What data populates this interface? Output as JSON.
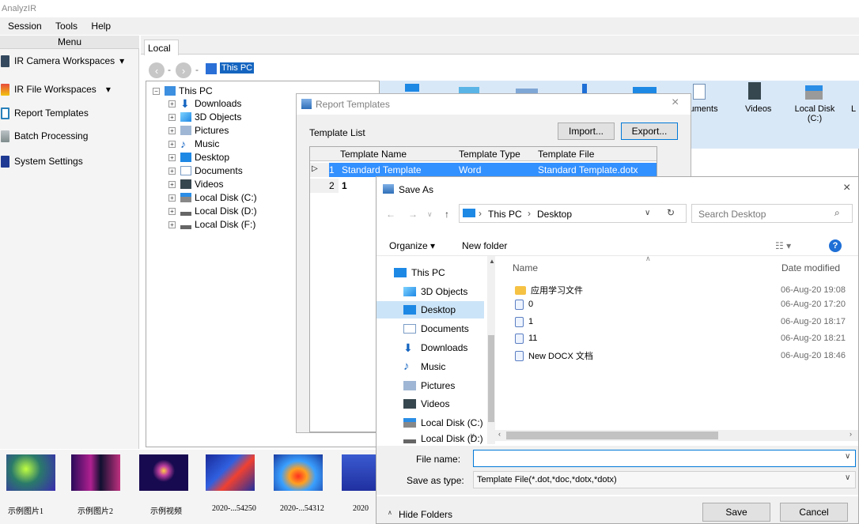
{
  "app": {
    "title": "AnalyzIR"
  },
  "menu": [
    "Session",
    "Tools",
    "Help"
  ],
  "left_panel": {
    "header": "Menu",
    "items": [
      {
        "label": "IR Camera Workspaces",
        "arrow": "▾",
        "color": "#34495e"
      },
      {
        "label": "IR File Workspaces",
        "arrow": "▾",
        "color": "#c0392b"
      },
      {
        "label": "Report Templates",
        "arrow": "",
        "color": "#2980b9"
      },
      {
        "label": "Batch Processing",
        "arrow": "",
        "color": "#7f8c8d"
      },
      {
        "label": "System Settings",
        "arrow": "",
        "color": "#1f3a93"
      }
    ]
  },
  "local_tab": "Local",
  "address": {
    "path": "This PC",
    "separator": "-"
  },
  "tree": {
    "root": "This PC",
    "items": [
      "Downloads",
      "3D Objects",
      "Pictures",
      "Music",
      "Desktop",
      "Documents",
      "Videos",
      "Local Disk (C:)",
      "Local Disk (D:)",
      "Local Disk (F:)"
    ]
  },
  "explorer_icons": [
    {
      "label": "cuments"
    },
    {
      "label": "Videos"
    },
    {
      "label": "Local Disk\n(C:)"
    },
    {
      "label": "L"
    }
  ],
  "thumbnails": [
    "示例图片1",
    "示例图片2",
    "示例视频",
    "2020-...54250",
    "2020-...54312",
    "2020"
  ],
  "report_templates": {
    "title": "Report Templates",
    "close": "×",
    "list_label": "Template List",
    "import_label": "Import...",
    "export_label": "Export...",
    "columns": [
      "Template Name",
      "Template Type",
      "Template File"
    ],
    "rows": [
      {
        "marker": "▷",
        "num": "1",
        "name": "Standard Template",
        "type": "Word",
        "file": "Standard Template.dotx"
      },
      {
        "marker": "",
        "num": "2",
        "name": "1",
        "type": "",
        "file": ""
      }
    ]
  },
  "save_as": {
    "title": "Save As",
    "close": "×",
    "breadcrumb": [
      "This PC",
      "Desktop"
    ],
    "search_placeholder": "Search Desktop",
    "organize": "Organize ▾",
    "new_folder": "New folder",
    "nav_items": [
      "This PC",
      "3D Objects",
      "Desktop",
      "Documents",
      "Downloads",
      "Music",
      "Pictures",
      "Videos",
      "Local Disk (C:)",
      "Local Disk (D:)"
    ],
    "selected_nav": "Desktop",
    "columns": {
      "name": "Name",
      "date": "Date modified"
    },
    "files": [
      {
        "name": "应用学习文件",
        "date": "06-Aug-20 19:08",
        "kind": "folder"
      },
      {
        "name": "0",
        "date": "06-Aug-20 17:20",
        "kind": "file"
      },
      {
        "name": "1",
        "date": "06-Aug-20 18:17",
        "kind": "file"
      },
      {
        "name": "11",
        "date": "06-Aug-20 18:21",
        "kind": "file"
      },
      {
        "name": "New DOCX 文档",
        "date": "06-Aug-20 18:46",
        "kind": "file"
      }
    ],
    "file_name_label": "File name:",
    "file_name_value": "",
    "save_type_label": "Save as type:",
    "save_type_value": "Template File(*.dot,*doc,*dotx,*dotx)",
    "hide_folders": "Hide Folders",
    "save": "Save",
    "cancel": "Cancel"
  }
}
